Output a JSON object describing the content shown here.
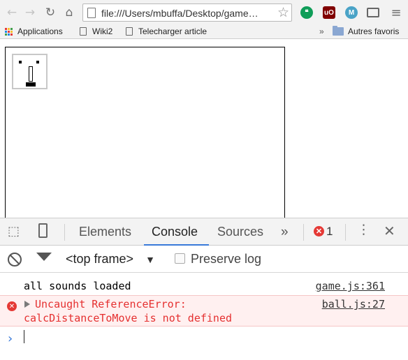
{
  "browser": {
    "address_bar": {
      "url": "file:///Users/mbuffa/Desktop/game…"
    },
    "extensions": [
      {
        "icon": "hangouts-icon",
        "color": "#0f9d58",
        "glyph": "❝"
      },
      {
        "icon": "ublock-icon",
        "color": "#800000",
        "glyph": "uO"
      },
      {
        "icon": "evernote-icon",
        "color": "#4aa3c7",
        "glyph": "M"
      }
    ],
    "bookmarks": {
      "apps": "Applications",
      "items": [
        "Wiki2",
        "Telecharger article"
      ],
      "overflow": "»",
      "other": "Autres favoris"
    }
  },
  "devtools": {
    "tabs": [
      "Elements",
      "Console",
      "Sources"
    ],
    "active_tab": "Console",
    "more": "»",
    "error_count": "1",
    "context": "<top frame>",
    "preserve_log_label": "Preserve log",
    "preserve_log_checked": false,
    "messages": [
      {
        "type": "log",
        "text": "all sounds loaded",
        "source": "game.js:361"
      },
      {
        "type": "error",
        "text_line1": "Uncaught ReferenceError:",
        "text_line2": "calcDistanceToMove is not defined",
        "source": "ball.js:27"
      }
    ]
  },
  "colors": {
    "accent": "#3879d9",
    "error": "#e53935"
  }
}
